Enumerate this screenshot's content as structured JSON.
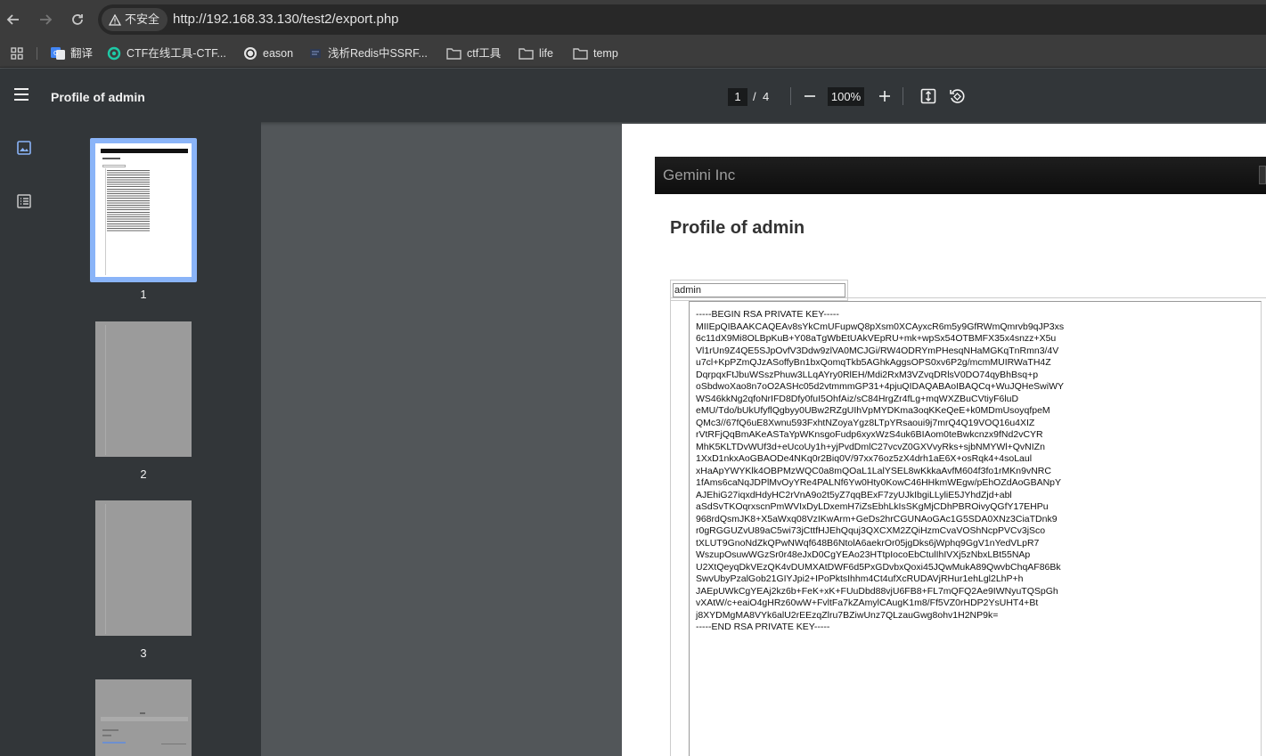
{
  "browser": {
    "security_label": "不安全",
    "url": "http://192.168.33.130/test2/export.php",
    "bookmarks": [
      {
        "label": "翻译",
        "icon": "google-translate-icon"
      },
      {
        "label": "CTF在线工具-CTF...",
        "icon": "globe-icon"
      },
      {
        "label": "eason",
        "icon": "openai-icon"
      },
      {
        "label": "浅析Redis中SSRF...",
        "icon": "page-icon"
      },
      {
        "label": "ctf工具",
        "icon": "folder-icon"
      },
      {
        "label": "life",
        "icon": "folder-icon"
      },
      {
        "label": "temp",
        "icon": "folder-icon"
      }
    ]
  },
  "viewer": {
    "title": "Profile of admin",
    "current_page": "1",
    "page_separator": "/",
    "total_pages": "4",
    "zoom": "100%",
    "thumbnails": [
      {
        "label": "1",
        "selected": true
      },
      {
        "label": "2",
        "selected": false
      },
      {
        "label": "3",
        "selected": false
      }
    ]
  },
  "document": {
    "brand": "Gemini Inc",
    "heading": "Profile of admin",
    "username": "admin",
    "private_key": "-----BEGIN RSA PRIVATE KEY-----\nMIIEpQIBAAKCAQEAv8sYkCmUFupwQ8pXsm0XCAyxcR6m5y9GfRWmQmrvb9qJP3xs\n6c11dX9Mi8OLBpKuB+Y08aTgWbEtUAkVEpRU+mk+wpSx54OTBMFX35x4snzz+X5u\nVl1rUn9Z4QE5SJpOvfV3Ddw9zlVA0MCJGi/RW4ODRYmPHesqNHaMGKqTnRmn3/4V\nu7cl+KpPZmQJzASoffyBn1bxQomqTkb5AGhkAggsOPS0xv6P2g/mcmMUIRWaTH4Z\nDqrpqxFtJbuWSszPhuw3LLqAYry0RlEH/Mdi2RxM3VZvqDRlsV0DO74qyBhBsq+p\noSbdwoXao8n7oO2ASHc05d2vtmmmGP31+4pjuQIDAQABAoIBAQCq+WuJQHeSwiWY\nWS46kkNg2qfoNrIFD8Dfy0fuI5OhfAiz/sC84HrgZr4fLg+mqWXZBuCVtiyF6luD\neMU/Tdo/bUkUfyflQgbyy0UBw2RZgUIhVpMYDKma3oqKKeQeE+k0MDmUsoyqfpeM\nQMc3//67fQ6uE8Xwnu593FxhtNZoyaYgz8LTpYRsaoui9j7mrQ4Q19VOQ16u4XIZ\nrVtRFjQqBmAKeASTaYpWKnsgoFudp6xyxWzS4uk6BIAom0teBwkcnzx9fNd2vCYR\nMhK5KLTDvWUf3d+eUcoUy1h+yjPvdDmlC27vcvZ0GXVvyRks+sjbNMYWl+QvNIZn\n1XxD1nkxAoGBAODe4NKq0r2Biq0V/97xx76oz5zX4drh1aE6X+osRqk4+4soLaul\nxHaApYWYKlk4OBPMzWQC0a8mQOaL1LalYSEL8wKkkaAvfM604f3fo1rMKn9vNRC\n1fAms6caNqJDPlMvOyYRe4PALNf6Yw0Hty0KowC46HHkmWEgw/pEhOZdAoGBANpY\nAJEhiG27iqxdHdyHC2rVnA9o2t5yZ7qqBExF7zyUJkIbgiLLyliE5JYhdZjd+abl\naSdSvTKOqrxscnPmWVIxDyLDxemH7iZsEbhLkIsSKgMjCDhPBROivyQGfY17EHPu\n968rdQsmJK8+X5aWxq08VzIKwArm+GeDs2hrCGUNAoGAc1G5SDA0XNz3CiaTDnk9\nr0gRGGUZvU89aC5wi73jCttfHJEhQquj3QXCXM2ZQiHzmCvaVOShNcpPVCv3jSco\ntXLUT9GnoNdZkQPwNWqf648B6NtolA6aekrOr05jgDks6jWphq9GgV1nYedVLpR7\nWszupOsuwWGzSr0r48eJxD0CgYEAo23HTtpIocoEbCtulIhIVXj5zNbxLBt55NAp\nU2XtQeyqDkVEzQK4vDUMXAtDWF6d5PxGDvbxQoxi45JQwMukA89QwvbChqAF86Bk\nSwvUbyPzalGob21GIYJpi2+IPoPktsIhhm4Ct4ufXcRUDAVjRHur1ehLgl2LhP+h\nJAEpUWkCgYEAj2kz6b+FeK+xK+FUuDbd88vjU6FB8+FL7mQFQ2Ae9IWNyuTQSpGh\nvXAtW/c+eaiO4gHRz60wW+FvltFa7kZAmylCAugK1m8/Ff5VZ0rHDP2YsUHT4+Bt\nj8XYDMgMA8VYk6alU2rEEzqZlru7BZiwUnz7QLzauGwg8ohv1H2NP9k=\n-----END RSA PRIVATE KEY-----"
  }
}
